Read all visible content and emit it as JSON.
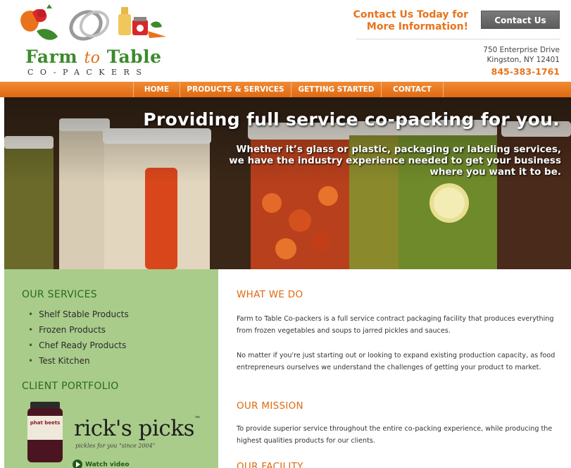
{
  "colors": {
    "brand_green": "#3c8a2c",
    "brand_orange": "#e8731c",
    "nav_orange": "#e06a12",
    "sidebar_green": "#a9cc8a",
    "button_gray": "#6a6a6a"
  },
  "header": {
    "logo": {
      "name_part1": "Farm",
      "name_to": "to",
      "name_part2": "Table",
      "subtitle": "CO-PACKERS"
    },
    "cta_text": "Contact Us Today for More Information!",
    "contact_button": "Contact Us",
    "address_line1": "750 Enterprise Drive",
    "address_line2": "Kingston, NY 12401",
    "phone": "845-383-1761"
  },
  "nav": {
    "items": [
      {
        "label": "HOME"
      },
      {
        "label": "PRODUCTS & SERVICES"
      },
      {
        "label": "GETTING STARTED"
      },
      {
        "label": "CONTACT"
      }
    ]
  },
  "hero": {
    "title": "Providing full service co-packing for you.",
    "body": "Whether it’s glass or plastic, packaging or labeling services, we have the industry experience needed to get your business where you want it to be."
  },
  "sidebar": {
    "services_heading": "OUR SERVICES",
    "services": [
      {
        "label": "Shelf Stable Products"
      },
      {
        "label": "Frozen Products"
      },
      {
        "label": "Chef Ready Products"
      },
      {
        "label": "Test Kitchen"
      }
    ],
    "portfolio_heading": "CLIENT PORTFOLIO",
    "portfolio": {
      "brand": "rick's picks",
      "tagline": "pickles for you \"since 2004\"",
      "jar_label": "phat beets",
      "watch_label": "Watch video"
    }
  },
  "main": {
    "what_heading": "WHAT WE DO",
    "what_p1": "Farm to Table Co-packers is a full service contract packaging facility that produces everything from frozen vegetables and soups to jarred pickles and sauces.",
    "what_p2": "No matter if you're just starting out or looking to expand existing production capacity, as food entrepreneurs ourselves we understand the challenges of getting your product to market.",
    "mission_heading": "OUR MISSION",
    "mission_p": "To provide superior service throughout the entire co-packing experience, while producing the highest qualities products for our clients.",
    "facility_heading": "OUR FACILITY"
  }
}
